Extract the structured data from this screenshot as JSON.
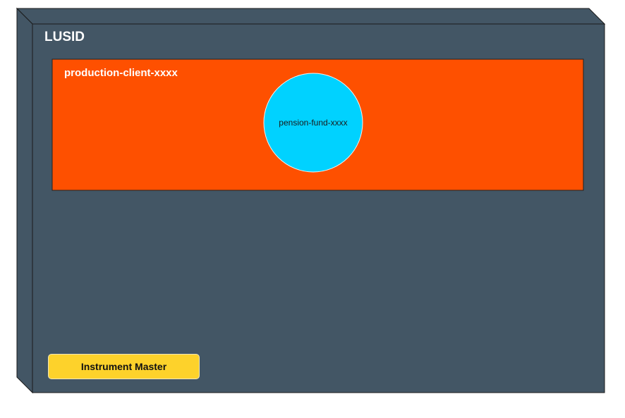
{
  "lusid": {
    "title": "LUSID",
    "fill_color": "#435665",
    "side_color": "#435665"
  },
  "client_environment": {
    "title": "production-client-xxxx",
    "fill_color": "#fe5000"
  },
  "pension_fund": {
    "label": "pension-fund-xxxx",
    "fill_color": "#00d2ff"
  },
  "instrument_master": {
    "label": "Instrument Master",
    "fill_color": "#fdd22b"
  }
}
